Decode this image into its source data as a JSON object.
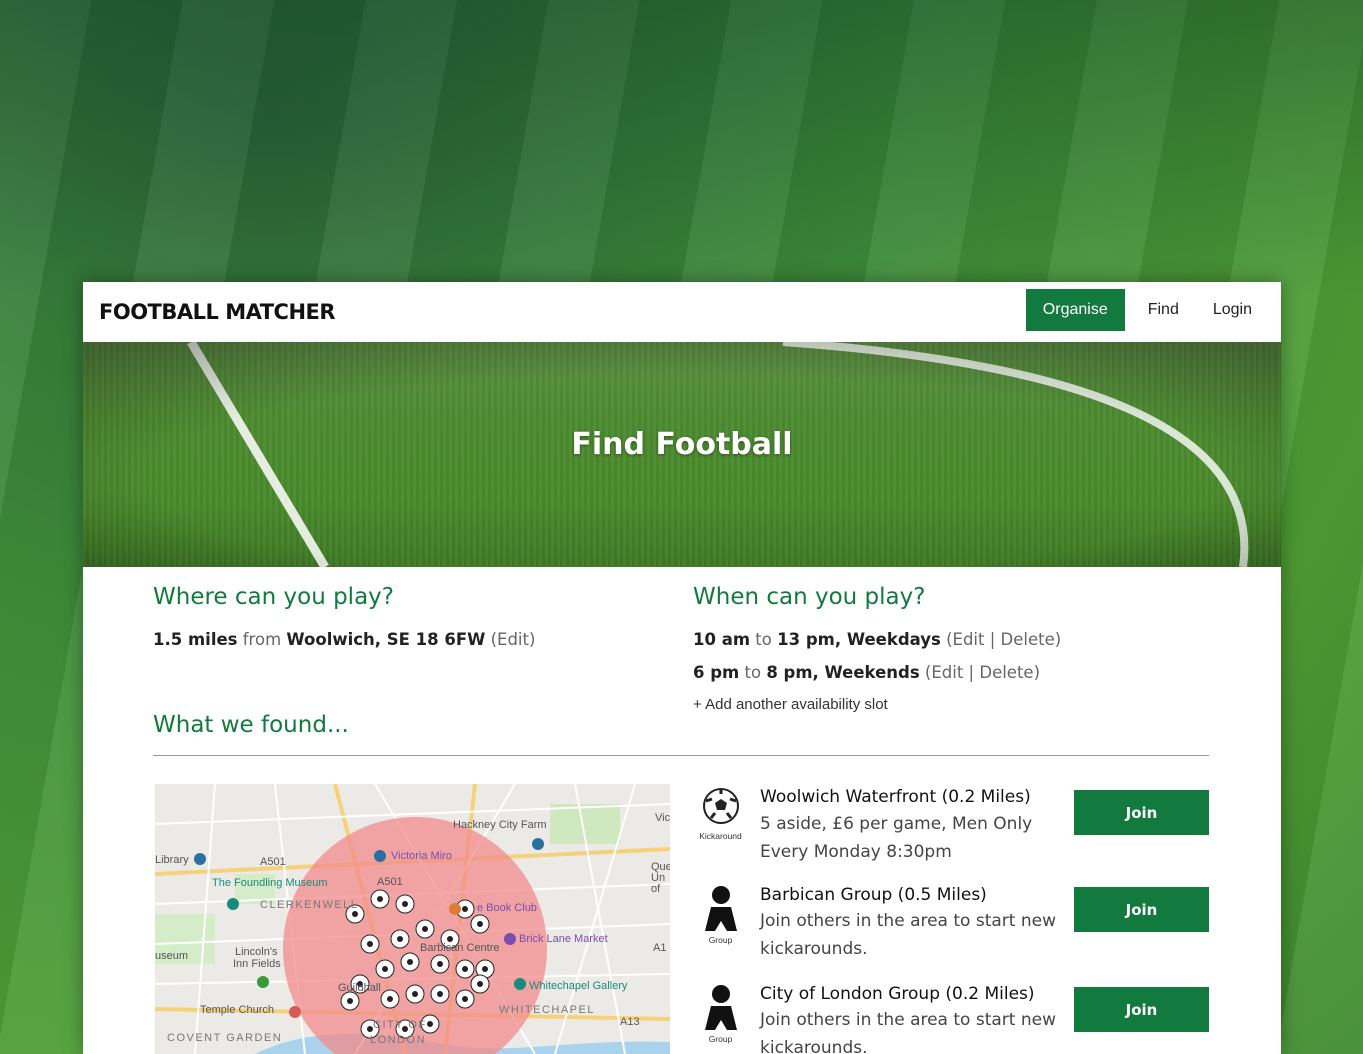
{
  "brand": {
    "logo_text": "FOOTBALL MATCHER"
  },
  "nav": {
    "organise": "Organise",
    "find": "Find",
    "login": "Login"
  },
  "hero": {
    "title": "Find Football"
  },
  "where": {
    "heading": "Where can you play?",
    "distance": "1.5 miles",
    "from_word": "from",
    "location": "Woolwich, SE 18 6FW",
    "edit": "(Edit)"
  },
  "when": {
    "heading": "When can you play?",
    "slots": [
      {
        "start": "10 am",
        "to": "to",
        "end": "13 pm, Weekdays",
        "open": "(",
        "edit": "Edit",
        "sep": "|",
        "delete": "Delete",
        "close": ")"
      },
      {
        "start": "6 pm",
        "to": "to",
        "end": "8 pm, Weekends",
        "open": "(",
        "edit": "Edit",
        "sep": "|",
        "delete": "Delete",
        "close": ")"
      }
    ],
    "add_slot": "+ Add another availability slot"
  },
  "found": {
    "heading": "What we found..."
  },
  "map": {
    "labels": [
      "Hackney City Farm",
      "Victoria Miro",
      "Library",
      "A501",
      "The Foundling Museum",
      "CLERKENWELL",
      "e Book Club",
      "Brick Lane Market",
      "Barbican Centre",
      "Lincoln's",
      "Inn Fields",
      "useum",
      "Whitechapel Gallery",
      "Guildhall",
      "Temple Church",
      "WHITECHAPEL",
      "COVENT GARDEN",
      "CITY OF",
      "LONDON",
      "A13",
      "A501",
      "A1",
      "Vic",
      "Que Un of"
    ]
  },
  "results": [
    {
      "icon": "football-icon",
      "icon_caption": "Kickaround",
      "title": "Woolwich Waterfront (0.2 Miles)",
      "line1": "5 aside, £6 per game, Men Only",
      "line2": "Every Monday 8:30pm",
      "join": "Join"
    },
    {
      "icon": "group-icon",
      "icon_caption": "Group",
      "title": "Barbican Group (0.5 Miles)",
      "line1": "Join others in the area to start new",
      "line2": "kickarounds.",
      "join": "Join"
    },
    {
      "icon": "group-icon",
      "icon_caption": "Group",
      "title": "City of London Group (0.2 Miles)",
      "line1": "Join others in the area to start new",
      "line2": "kickarounds.",
      "join": "Join"
    }
  ],
  "colors": {
    "brand_green": "#127a3e",
    "heading_green": "#127a3e",
    "map_radius": "#f28b8b"
  }
}
